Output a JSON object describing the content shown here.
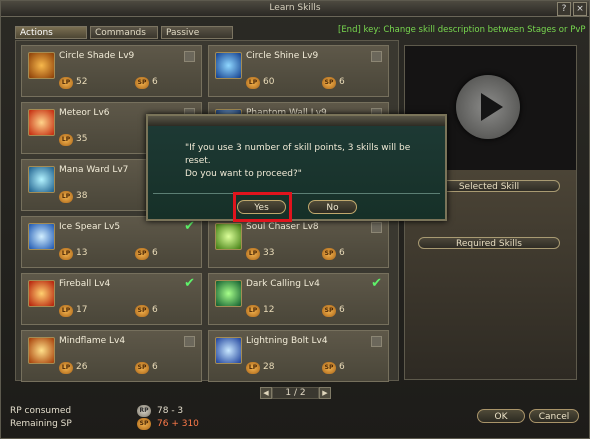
{
  "window": {
    "title": "Learn Skills",
    "help_label": "?",
    "close_label": "×"
  },
  "tabs": [
    {
      "label": "Actions",
      "active": true
    },
    {
      "label": "Commands",
      "active": false
    },
    {
      "label": "Passive",
      "active": false
    }
  ],
  "hint": "[End] key: Change skill description between Stages or PvP",
  "badges": {
    "lp": "LP",
    "sp": "SP"
  },
  "skills": [
    {
      "name": "Circle Shade Lv9",
      "lp": "52",
      "sp": "6",
      "checked": false
    },
    {
      "name": "Circle Shine Lv9",
      "lp": "60",
      "sp": "6",
      "checked": false
    },
    {
      "name": "Meteor Lv6",
      "lp": "35",
      "sp": "",
      "checked": false
    },
    {
      "name": "Phantom Wall Lv9",
      "lp": "",
      "sp": "",
      "checked": false
    },
    {
      "name": "Mana Ward Lv7",
      "lp": "38",
      "sp": "",
      "checked": false
    },
    {
      "name": "",
      "lp": "",
      "sp": "",
      "checked": false
    },
    {
      "name": "Ice Spear Lv5",
      "lp": "13",
      "sp": "6",
      "checked": true
    },
    {
      "name": "Soul Chaser Lv8",
      "lp": "33",
      "sp": "6",
      "checked": false
    },
    {
      "name": "Fireball Lv4",
      "lp": "17",
      "sp": "6",
      "checked": true
    },
    {
      "name": "Dark Calling Lv4",
      "lp": "12",
      "sp": "6",
      "checked": true
    },
    {
      "name": "Mindflame Lv4",
      "lp": "26",
      "sp": "6",
      "checked": false
    },
    {
      "name": "Lightning Bolt Lv4",
      "lp": "28",
      "sp": "6",
      "checked": false
    }
  ],
  "dialog": {
    "line1": "\"If you use 3 number of skill points, 3 skills will be reset.",
    "line2": "Do you want to proceed?\"",
    "yes_label": "Yes",
    "no_label": "No"
  },
  "side": {
    "selected_skill_label": "Selected Skill",
    "required_skills_label": "Required Skills"
  },
  "pager": {
    "text": "1 / 2"
  },
  "footer": {
    "rp_label": "RP consumed",
    "rp_badge": "RP",
    "rp_value": "78 - 3",
    "sp_label": "Remaining SP",
    "sp_badge": "SP",
    "sp_value": "76 + 310",
    "ok_label": "OK",
    "cancel_label": "Cancel"
  },
  "colors": {
    "hint": "#78d84f",
    "highlight": "#e0141d",
    "sp_value": "#ff7a4a",
    "check": "#5ef36a"
  }
}
